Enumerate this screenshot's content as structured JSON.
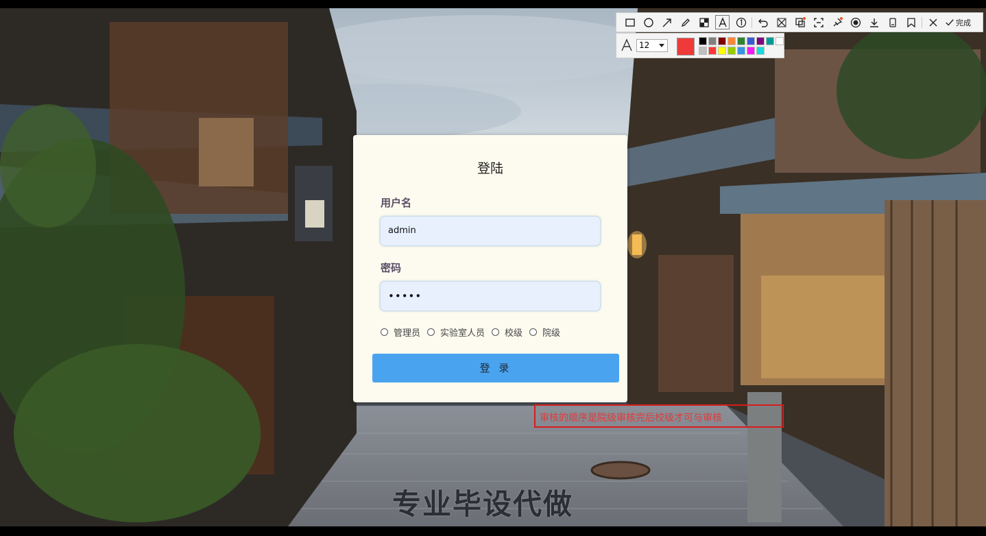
{
  "login": {
    "title": "登陆",
    "username_label": "用户名",
    "username_value": "admin",
    "password_label": "密码",
    "password_value": "•••••",
    "roles": [
      "管理员",
      "实验室人员",
      "校级",
      "院级"
    ],
    "submit_label": "登 录"
  },
  "annotation": {
    "text": "审核的顺序是院级审核完后校级才可与审核",
    "color": "#d81c1c"
  },
  "watermark": "专业毕设代做",
  "toolbar": {
    "tools": [
      "rectangle-icon",
      "ellipse-icon",
      "arrow-icon",
      "pen-icon",
      "mosaic-icon",
      "text-icon",
      "number-icon",
      "undo-icon",
      "redo-icon",
      "translate-icon",
      "ocr-icon",
      "pin-icon",
      "record-icon",
      "download-icon",
      "save-icon",
      "bookmark-icon",
      "close-icon"
    ],
    "done_label": "完成",
    "font_size": "12",
    "current_color": "#f03a3a",
    "palette": [
      "#000000",
      "#808080",
      "#800000",
      "#f7883a",
      "#308430",
      "#385ad3",
      "#800080",
      "#009999",
      "#ffffff",
      "#c0c0c0",
      "#fb3838",
      "#ffff00",
      "#99cc00",
      "#3894e4",
      "#f31bf3",
      "#16dcdc"
    ]
  }
}
